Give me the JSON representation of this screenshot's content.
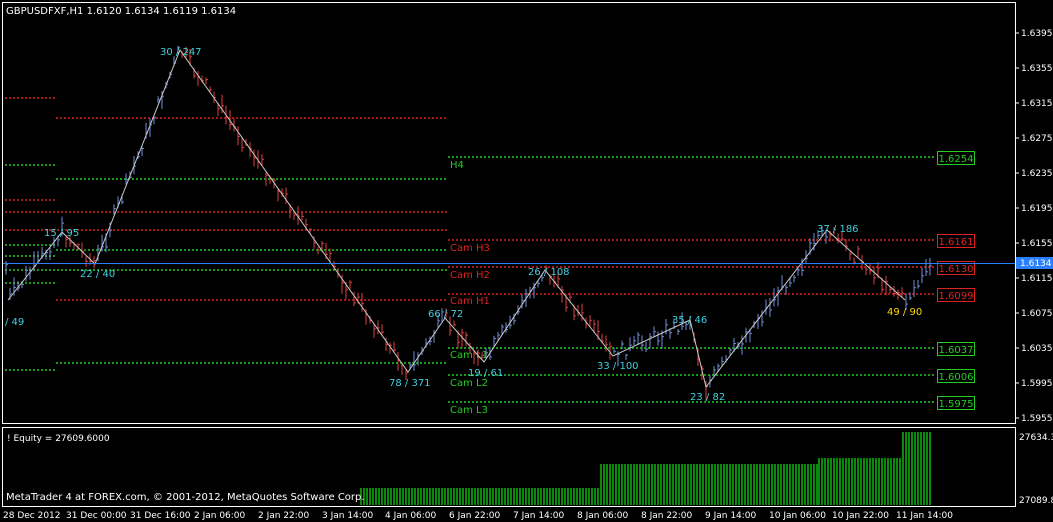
{
  "header": {
    "symbol_info": "GBPUSDFXF,H1  1.6120 1.6134 1.6119 1.6134"
  },
  "main_chart": {
    "price_axis_labels": [
      "1.6395",
      "1.6355",
      "1.6315",
      "1.6275",
      "1.6235",
      "1.6195",
      "1.6155",
      "1.6115",
      "1.6075",
      "1.6035",
      "1.5995",
      "1.5955"
    ],
    "current_price": "1.6134",
    "zigzag_labels": [
      {
        "text": "/ 49",
        "color": "#3fd0e0"
      },
      {
        "text": "15 / 95",
        "color": "#3fd0e0"
      },
      {
        "text": "22 / 40",
        "color": "#3fd0e0"
      },
      {
        "text": "30 / 247",
        "color": "#3fd0e0"
      },
      {
        "text": "78 / 371",
        "color": "#3fd0e0"
      },
      {
        "text": "66 / 72",
        "color": "#3fd0e0"
      },
      {
        "text": "19 / 61",
        "color": "#3fd0e0"
      },
      {
        "text": "26 / 108",
        "color": "#3fd0e0"
      },
      {
        "text": "33 / 100",
        "color": "#3fd0e0"
      },
      {
        "text": "35 / 46",
        "color": "#3fd0e0"
      },
      {
        "text": "23 / 82",
        "color": "#3fd0e0"
      },
      {
        "text": "37 / 186",
        "color": "#3fd0e0"
      },
      {
        "text": "49 / 90",
        "color": "#ffd700"
      }
    ],
    "camarilla": {
      "h4": {
        "label": "H4",
        "value": "1.6254"
      },
      "h3": {
        "label": "Cam H3",
        "value": "1.6161"
      },
      "h2": {
        "label": "Cam H2",
        "value": "1.6130"
      },
      "h1": {
        "label": "Cam H1",
        "value": "1.6099"
      },
      "l1": {
        "label": "Cam L1",
        "value": "1.6037"
      },
      "l2": {
        "label": "Cam L2",
        "value": "1.6006"
      },
      "l3": {
        "label": "Cam L3",
        "value": "1.5975"
      }
    }
  },
  "sub_window": {
    "indicator_label": "! Equity = 27609.6000",
    "axis_top": "27634.3",
    "axis_bottom": "27089.8"
  },
  "footer": {
    "copyright": "MetaTrader 4 at FOREX.com, © 2001-2012, MetaQuotes Software Corp."
  },
  "time_axis": [
    "28 Dec 2012",
    "31 Dec 00:00",
    "31 Dec 16:00",
    "2 Jan 06:00",
    "2 Jan 22:00",
    "3 Jan 14:00",
    "4 Jan 06:00",
    "6 Jan 22:00",
    "7 Jan 14:00",
    "8 Jan 06:00",
    "8 Jan 22:00",
    "9 Jan 14:00",
    "10 Jan 06:00",
    "10 Jan 22:00",
    "11 Jan 14:00"
  ],
  "colors": {
    "up_bar": "#6f8fd8",
    "down_bar": "#e04040",
    "grid_green": "#22cc22",
    "grid_red": "#dd2222",
    "price_line": "#2a7fff",
    "zigzag": "#c8c8c8",
    "equity_bar": "#0a8a0a"
  }
}
